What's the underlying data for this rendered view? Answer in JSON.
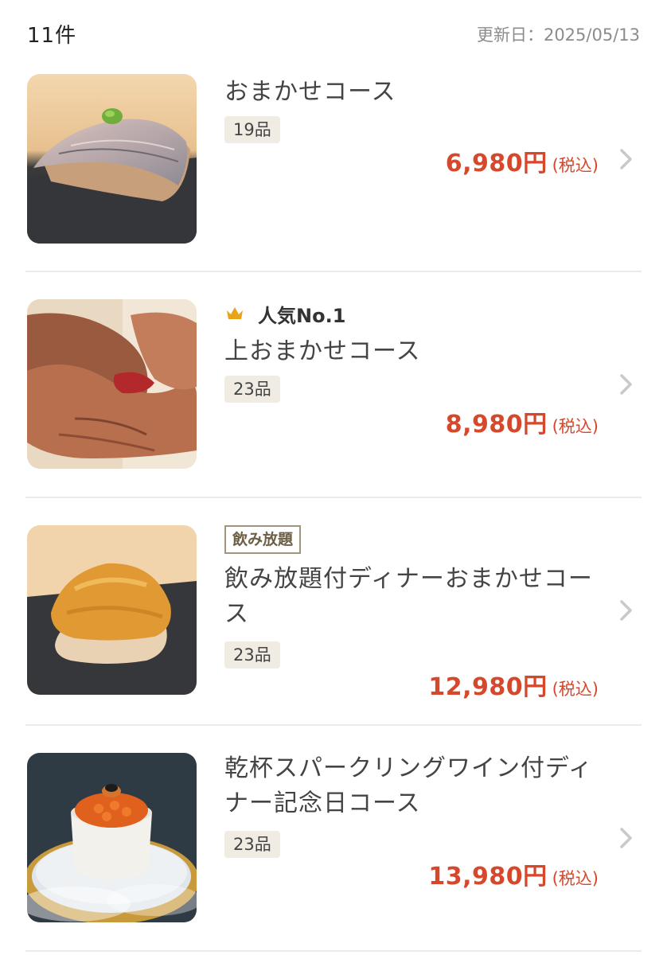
{
  "header": {
    "count": "11件",
    "updated": "更新日：2025/05/13"
  },
  "items": [
    {
      "title": "おまかせコース",
      "qty": "19品",
      "price": "6,980円",
      "tax": "(税込)",
      "image": "aji-nigiri-photo"
    },
    {
      "badge_icon": "crown-icon",
      "badge": "人気No.1",
      "title": "上おまかせコース",
      "qty": "23品",
      "price": "8,980円",
      "tax": "(税込)",
      "image": "tuna-hands-photo"
    },
    {
      "tag": "飲み放題",
      "title_line1": "飲み放題付ディナーおまかせコー",
      "title_line2": "ス",
      "qty": "23品",
      "price": "12,980円",
      "tax": "(税込)",
      "image": "uni-nigiri-photo"
    },
    {
      "title_line1": "乾杯スパークリングワイン付ディ",
      "title_line2": "ナー記念日コース",
      "qty": "23品",
      "price": "13,980円",
      "tax": "(税込)",
      "image": "ikura-cup-photo"
    }
  ],
  "colors": {
    "price": "#d5482c",
    "qty_bg": "#f1ece3",
    "crown": "#e8a21b",
    "tag_border": "#a3957b"
  }
}
